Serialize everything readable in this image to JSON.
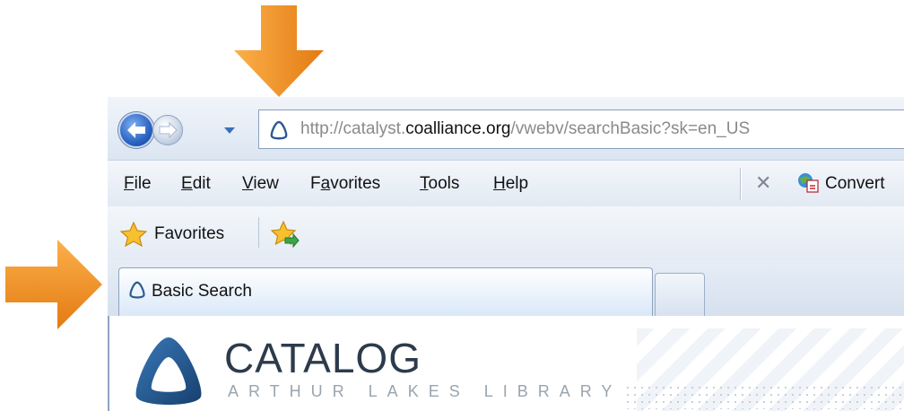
{
  "colors": {
    "arrow_orange": "#f28c1e",
    "arrow_orange_light": "#fbb04a",
    "logo_blue": "#1f4f86",
    "catalog_text": "#2c3b4c"
  },
  "nav": {
    "back_icon": "back-arrow-icon",
    "forward_icon": "forward-arrow-icon",
    "recent_pages_icon": "chevron-down-icon"
  },
  "address_bar": {
    "scheme": "http://catalyst.",
    "host": "coalliance.org",
    "path": "/vwebv/searchBasic?sk=en_US"
  },
  "menu": {
    "items": [
      {
        "accel": "F",
        "rest": "ile"
      },
      {
        "accel": "E",
        "rest": "dit"
      },
      {
        "accel": "V",
        "rest": "iew"
      },
      {
        "pre": "F",
        "accel": "a",
        "rest": "vorites"
      },
      {
        "accel": "T",
        "rest": "ools"
      },
      {
        "accel": "H",
        "rest": "elp"
      }
    ],
    "stop_glyph": "✕",
    "convert_label": "Convert"
  },
  "favorites_bar": {
    "label": "Favorites"
  },
  "tab": {
    "title": "Basic Search"
  },
  "page": {
    "title": "CATALOG",
    "subtitle": "ARTHUR LAKES LIBRARY"
  }
}
